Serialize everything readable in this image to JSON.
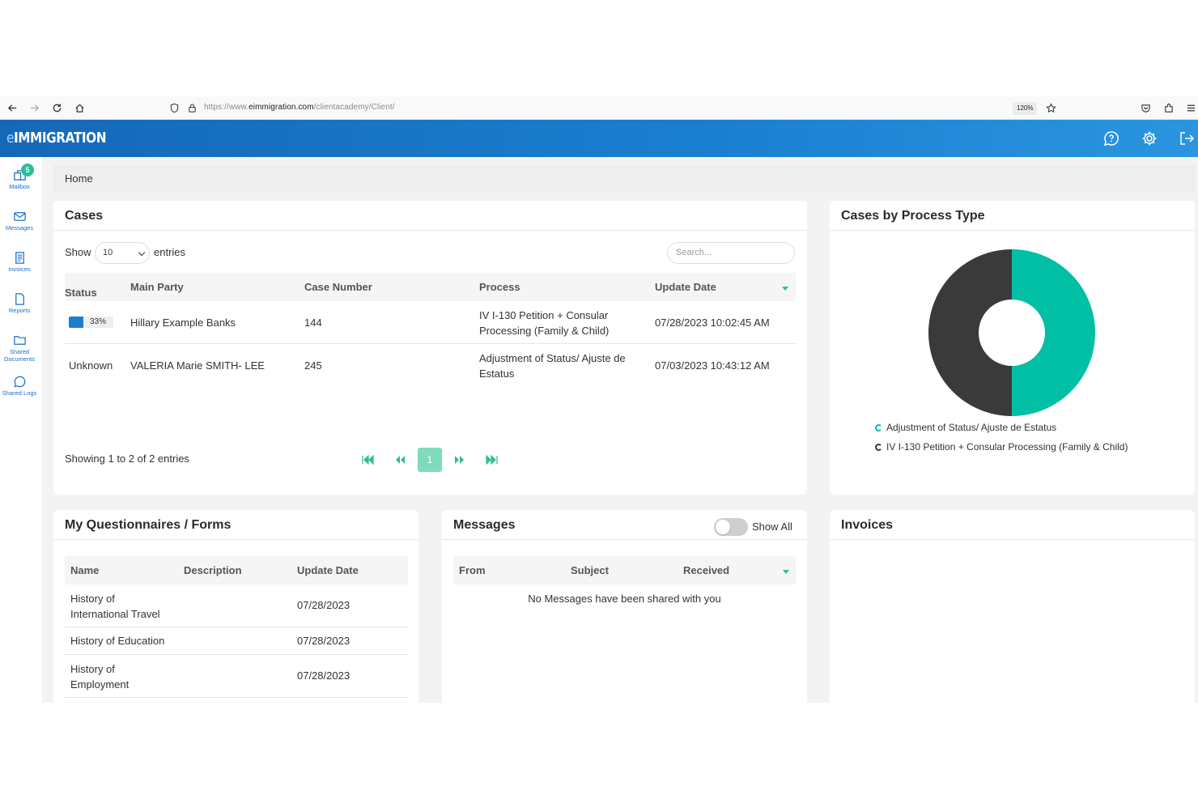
{
  "browser": {
    "url_prefix": "https://www.",
    "url_domain": "eimmigration.com",
    "url_path": "/clientacademy/Client/",
    "zoom": "120%"
  },
  "app": {
    "logo_e": "e",
    "logo_rest": "IMMIGRATION"
  },
  "sidebar": {
    "items": [
      {
        "label": "Mailbox",
        "icon": "mailbox-icon",
        "badge": "5"
      },
      {
        "label": "Messages",
        "icon": "envelope-icon"
      },
      {
        "label": "Invoices",
        "icon": "invoice-icon"
      },
      {
        "label": "Reports",
        "icon": "report-icon"
      },
      {
        "label": "Shared Documents",
        "icon": "folder-icon"
      },
      {
        "label": "Shared Logs",
        "icon": "chat-icon"
      }
    ]
  },
  "breadcrumb": "Home",
  "cases": {
    "title": "Cases",
    "show_label": "Show",
    "entries_label": "entries",
    "page_size": "10",
    "search_placeholder": "Search...",
    "columns": [
      "Status",
      "Main Party",
      "Case Number",
      "Process",
      "Update Date"
    ],
    "rows": [
      {
        "status": "33%",
        "progress": 0.33,
        "main_party": "Hillary Example Banks",
        "case_number": "144",
        "process": "IV I-130 Petition + Consular Processing (Family & Child)",
        "update_date": "07/28/2023 10:02:45 AM"
      },
      {
        "status": "Unknown",
        "main_party": "VALERIA Marie SMITH- LEE",
        "case_number": "245",
        "process": "Adjustment of Status/ Ajuste de Estatus",
        "update_date": "07/03/2023 10:43:12 AM"
      }
    ],
    "summary": "Showing 1 to 2 of 2 entries",
    "current_page": "1"
  },
  "chart_card": {
    "title": "Cases by Process Type"
  },
  "chart_data": {
    "type": "pie",
    "categories": [
      "Adjustment of Status/ Ajuste de Estatus",
      "IV I-130 Petition + Consular Processing (Family & Child)"
    ],
    "values": [
      1,
      1
    ],
    "colors": [
      "#00bfa5",
      "#3a3a3a"
    ],
    "donut": true,
    "legend_position": "bottom"
  },
  "questionnaires": {
    "title": "My Questionnaires / Forms",
    "columns": [
      "Name",
      "Description",
      "Update Date"
    ],
    "rows": [
      {
        "name": "History of International Travel",
        "description": "",
        "update_date": "07/28/2023"
      },
      {
        "name": "History of Education",
        "description": "",
        "update_date": "07/28/2023"
      },
      {
        "name": "History of Employment",
        "description": "",
        "update_date": "07/28/2023"
      }
    ]
  },
  "messages": {
    "title": "Messages",
    "show_all_label": "Show All",
    "columns": [
      "From",
      "Subject",
      "Received"
    ],
    "empty_text": "No Messages have been shared with you"
  },
  "invoices": {
    "title": "Invoices"
  },
  "colors": {
    "header_blue": "#1a7fd0",
    "accent_green": "#2bbf95",
    "chart_teal": "#00bfa5",
    "chart_dark": "#3a3a3a"
  }
}
